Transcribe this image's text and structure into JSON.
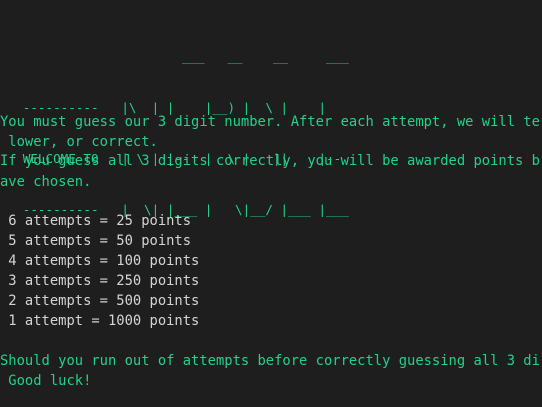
{
  "terminal": {
    "banner": [
      "                        ___   __    __     ___",
      "   ----------   |\\  | |    |__) |  \\ |    |",
      "   WELCOME TO   | \\ | |--  |  \\ |   ||    |--",
      "   ----------   |  \\| |___ |   \\|__/ |___ |___"
    ],
    "intro_lines": [
      "You must guess our 3 digit number. After each attempt, we will te",
      " lower, or correct.",
      "If you guess all 3 digits correctly, you will be awarded points b",
      "ave chosen."
    ],
    "points_table": [
      " 6 attempts = 25 points",
      " 5 attempts = 50 points",
      " 4 attempts = 100 points",
      " 3 attempts = 250 points",
      " 2 attempts = 500 points",
      " 1 attempt = 1000 points"
    ],
    "outro_lines": [
      "Should you run out of attempts before correctly guessing all 3 di",
      " Good luck!"
    ]
  },
  "colors": {
    "background": "#1e1e1e",
    "green": "#23d18b",
    "white": "#d4d4d4"
  }
}
